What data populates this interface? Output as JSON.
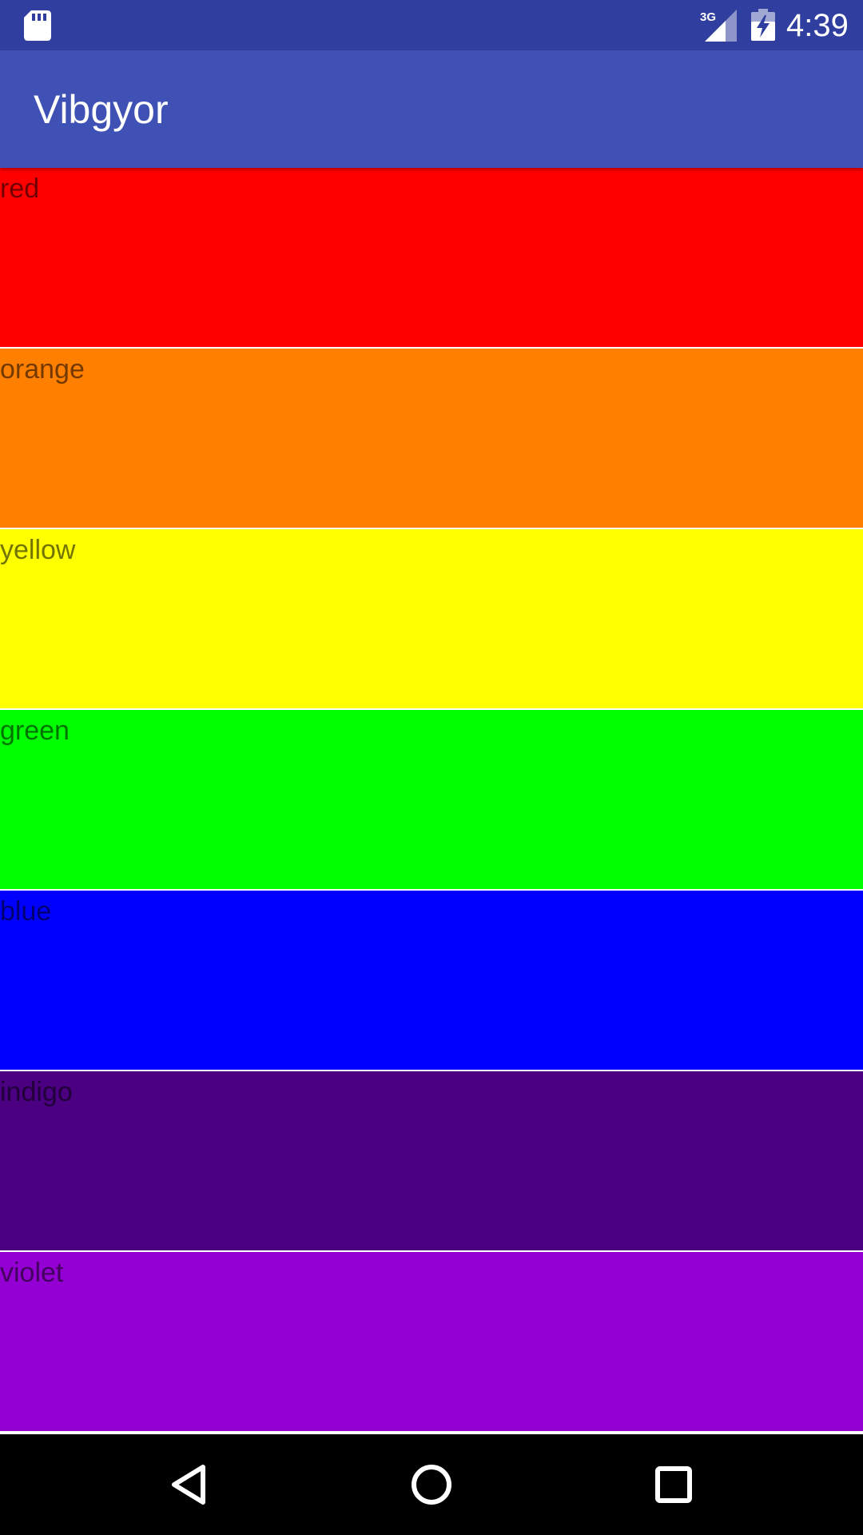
{
  "status_bar": {
    "time": "4:39",
    "network": "3G",
    "icons": [
      "sd-card-icon",
      "signal-icon",
      "battery-charging-icon"
    ],
    "background": "#303F9F"
  },
  "app_bar": {
    "title": "Vibgyor",
    "background": "#3F51B5"
  },
  "colors": [
    {
      "label": "red",
      "color": "#FF0000"
    },
    {
      "label": "orange",
      "color": "#FF7F00"
    },
    {
      "label": "yellow",
      "color": "#FFFF00"
    },
    {
      "label": "green",
      "color": "#00FF00"
    },
    {
      "label": "blue",
      "color": "#0000FF"
    },
    {
      "label": "indigo",
      "color": "#4B0082"
    },
    {
      "label": "violet",
      "color": "#9400D3"
    }
  ],
  "nav_bar": {
    "buttons": [
      "back-icon",
      "home-icon",
      "recent-apps-icon"
    ]
  }
}
